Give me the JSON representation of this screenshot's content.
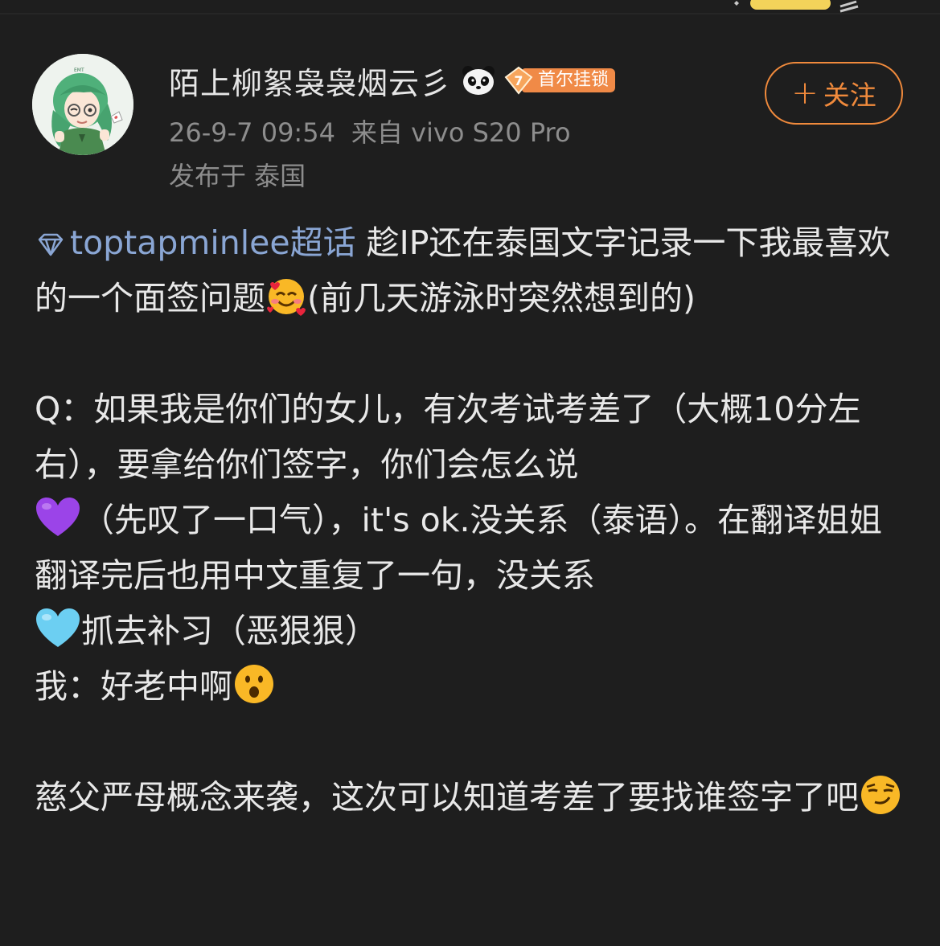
{
  "author": {
    "username": "陌上柳絮袅袅烟云彡",
    "fan_badge_level": "7",
    "fan_badge_label": "首尔挂锁"
  },
  "follow_button": {
    "plus": "+",
    "label": "关注"
  },
  "meta": {
    "datetime": "26-9-7 09:54",
    "source": "来自 vivo S20 Pro",
    "location": "发布于 泰国"
  },
  "post": {
    "topic": "toptapminlee超话",
    "p1": " 趁IP还在泰国文字记录一下我最喜欢的一个面签问题",
    "p1_tail": "(前几天游泳时突然想到的)",
    "q": "Q：如果我是你们的女儿，有次考试考差了（大概10分左右），要拿给你们签字，你们会怎么说",
    "purple": "（先叹了一口气），it's ok.没关系（泰语）。在翻译姐姐翻译完后也用中文重复了一句，没关系",
    "blue": "抓去补习（恶狠狠）",
    "me": "我：好老中啊",
    "ending": "慈父严母概念来袭，这次可以知道考差了要找谁签字了吧"
  },
  "emojis": {
    "p1_end": "smiling-face-with-hearts-emoji",
    "purple": "purple-heart-emoji",
    "blue": "light-blue-heart-emoji",
    "me_end": "surprised-face-emoji",
    "ending_end": "smirking-face-emoji"
  },
  "colors": {
    "background": "#1e1e1e",
    "text": "#e8e8e8",
    "muted": "#8d8d8d",
    "accent": "#f08a3c",
    "topic_link": "#8aa6d4"
  }
}
